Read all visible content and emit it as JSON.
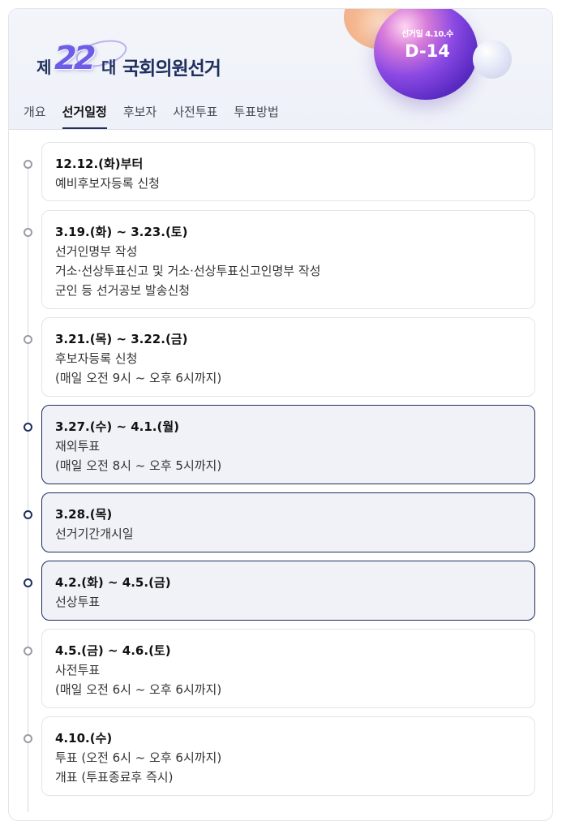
{
  "header": {
    "logo": {
      "prefix": "제",
      "number": "22",
      "suffix": "대",
      "title": "국회의원선거"
    },
    "election_day_label": "선거일 4.10.수",
    "dday": "D-14"
  },
  "tabs": [
    {
      "label": "개요",
      "active": false
    },
    {
      "label": "선거일정",
      "active": true
    },
    {
      "label": "후보자",
      "active": false
    },
    {
      "label": "사전투표",
      "active": false
    },
    {
      "label": "투표방법",
      "active": false
    }
  ],
  "events": [
    {
      "date": "12.12.(화)부터",
      "lines": [
        "예비후보자등록 신청"
      ],
      "current": false
    },
    {
      "date": "3.19.(화) ~ 3.23.(토)",
      "lines": [
        "선거인명부 작성",
        "거소·선상투표신고 및 거소·선상투표신고인명부 작성",
        "군인 등 선거공보 발송신청"
      ],
      "current": false
    },
    {
      "date": "3.21.(목) ~ 3.22.(금)",
      "lines": [
        "후보자등록 신청",
        "(매일 오전 9시 ~ 오후 6시까지)"
      ],
      "current": false
    },
    {
      "date": "3.27.(수) ~ 4.1.(월)",
      "lines": [
        "재외투표",
        "(매일 오전 8시 ~ 오후 5시까지)"
      ],
      "current": true
    },
    {
      "date": "3.28.(목)",
      "lines": [
        "선거기간개시일"
      ],
      "current": true
    },
    {
      "date": "4.2.(화) ~ 4.5.(금)",
      "lines": [
        "선상투표"
      ],
      "current": true
    },
    {
      "date": "4.5.(금) ~ 4.6.(토)",
      "lines": [
        "사전투표",
        "(매일 오전 6시 ~ 오후 6시까지)"
      ],
      "current": false
    },
    {
      "date": "4.10.(수)",
      "lines": [
        "투표 (오전 6시 ~ 오후 6시까지)",
        "개표 (투표종료후 즉시)"
      ],
      "current": false
    }
  ]
}
